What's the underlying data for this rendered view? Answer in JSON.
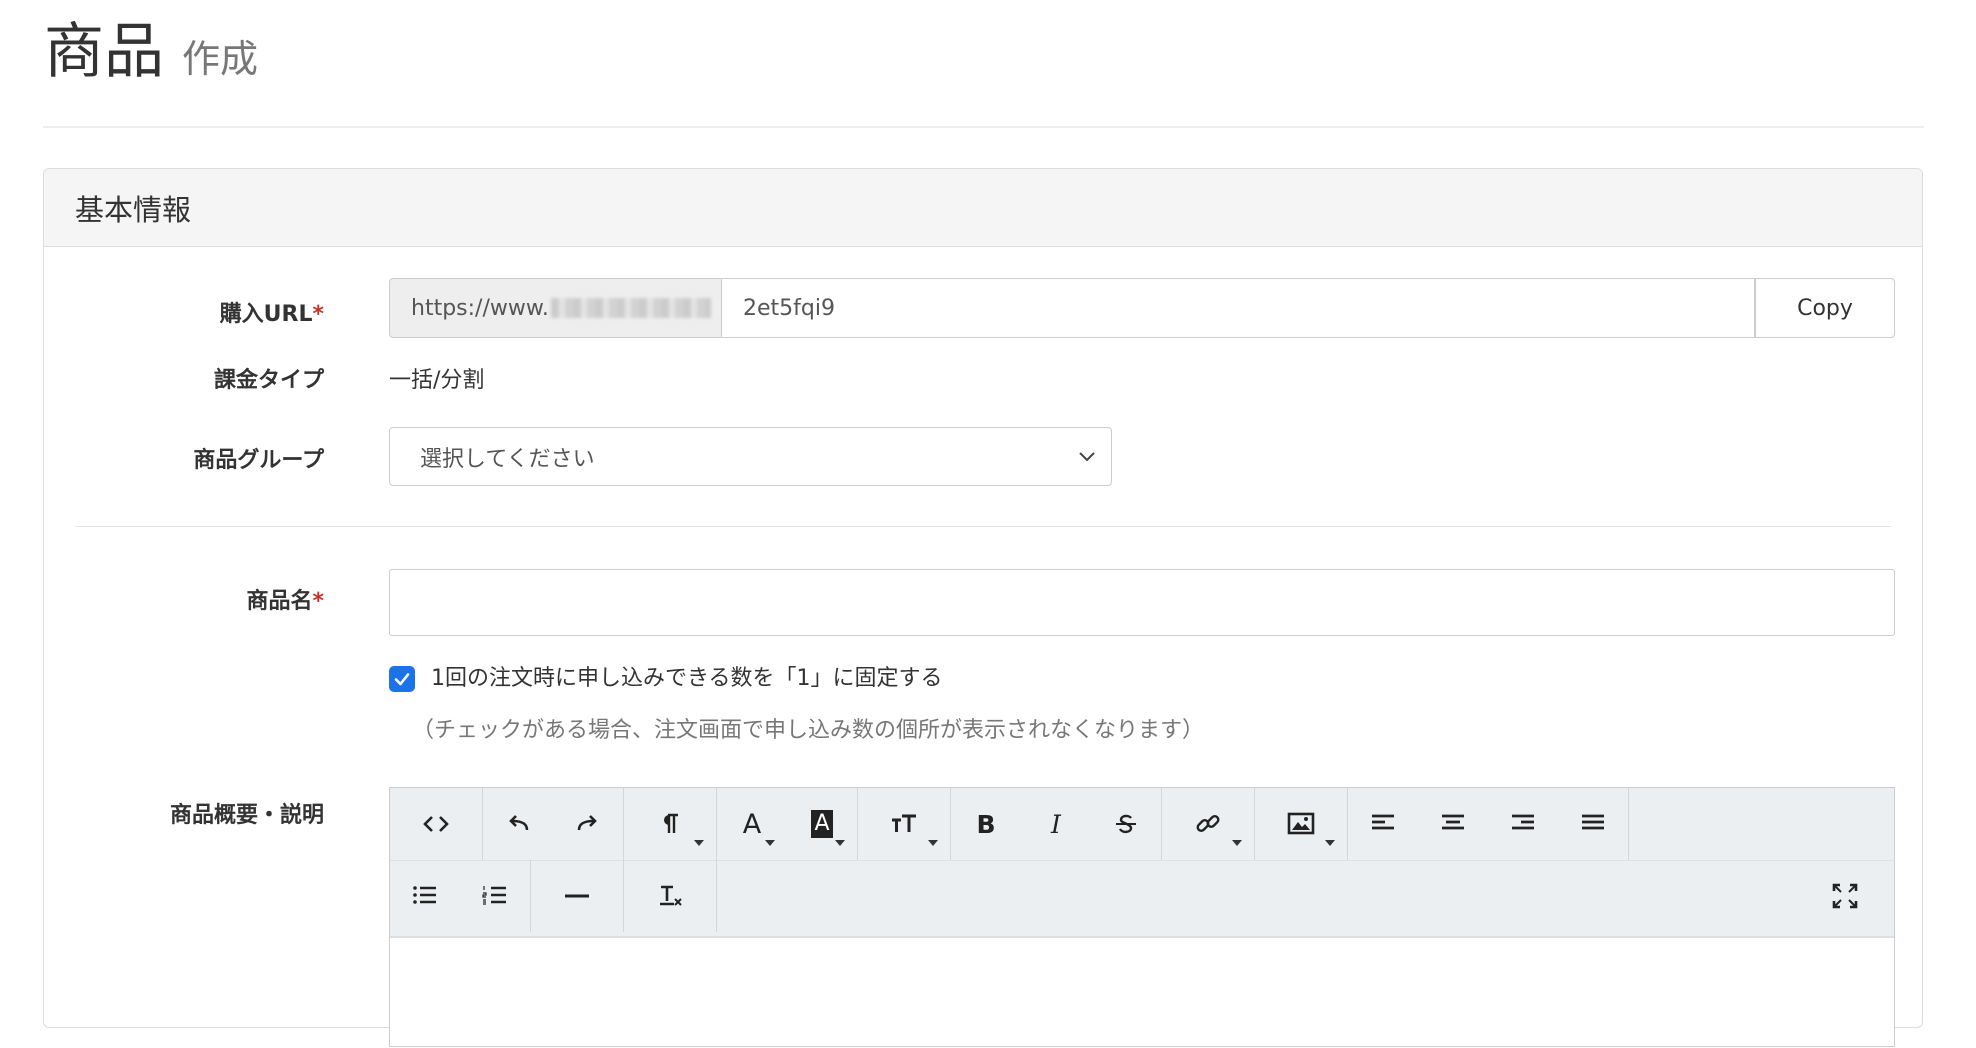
{
  "page": {
    "title": "商品",
    "subtitle": "作成"
  },
  "panel": {
    "heading": "基本情報"
  },
  "purchase_url": {
    "label": "購入URL",
    "required_mark": "*",
    "prefix": "https://www.",
    "value": "2et5fqi9",
    "copy_label": "Copy"
  },
  "billing": {
    "label": "課金タイプ",
    "value": "一括/分割"
  },
  "product_group": {
    "label": "商品グループ",
    "selected": "選択してください"
  },
  "product_name": {
    "label": "商品名",
    "required_mark": "*",
    "value": ""
  },
  "fix_quantity": {
    "checked": true,
    "label": "1回の注文時に申し込みできる数を「1」に固定する",
    "note": "（チェックがある場合、注文画面で申し込み数の個所が表示されなくなります）"
  },
  "description": {
    "label": "商品概要・説明",
    "toolbar": {
      "bold": "B",
      "italic": "I",
      "font_color": "A",
      "bg_color": "A"
    }
  },
  "colors": {
    "accent": "#1a73e8",
    "required": "#c9302c",
    "toolbar_bg": "#eceff1"
  }
}
